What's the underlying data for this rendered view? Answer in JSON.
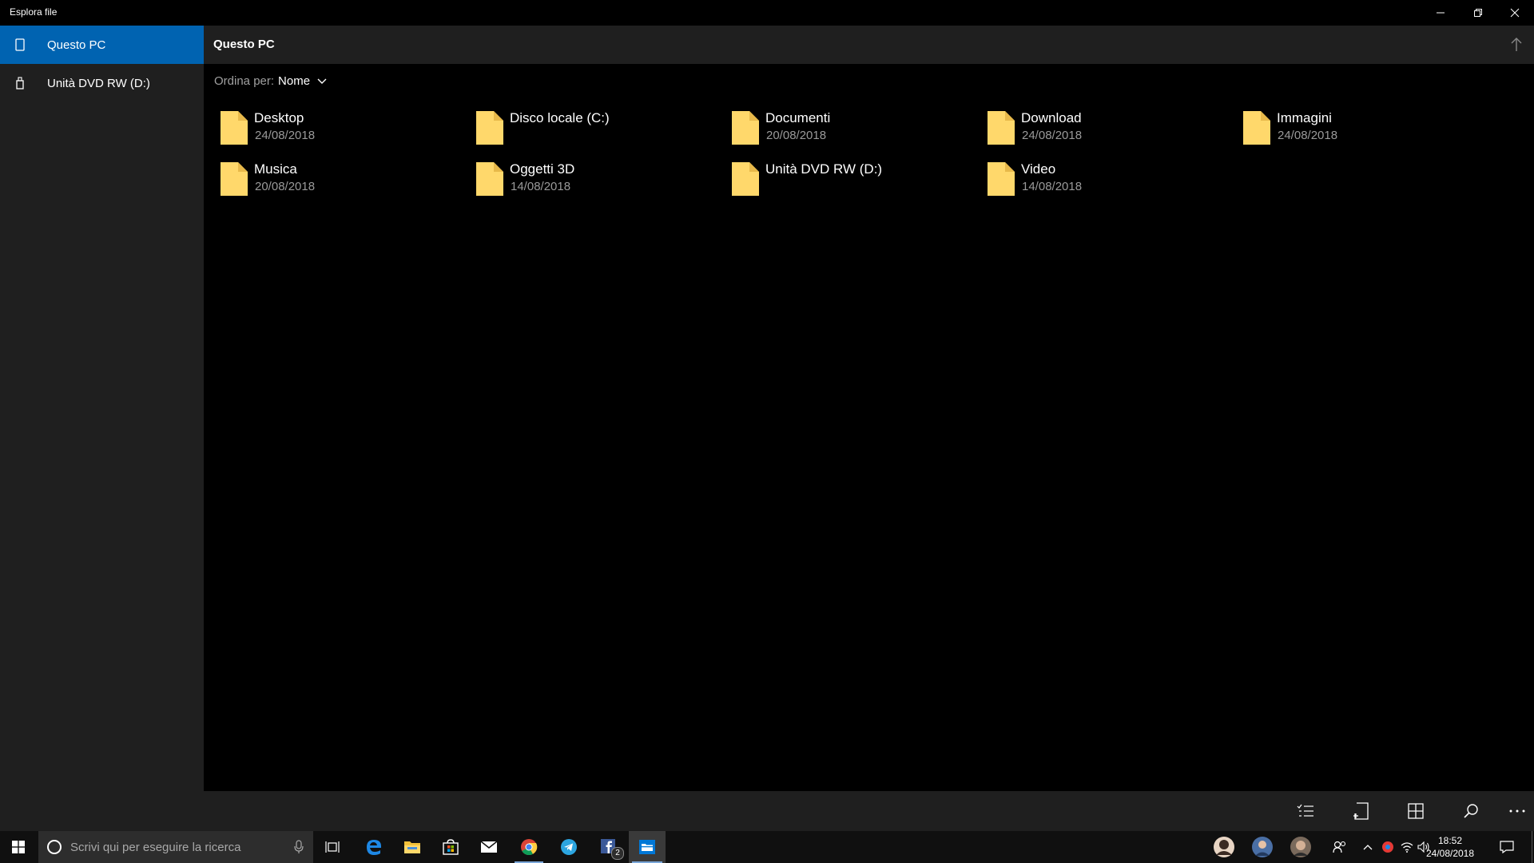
{
  "window": {
    "title": "Esplora file"
  },
  "sidebar": {
    "items": [
      {
        "label": "Questo PC",
        "icon": "phone-device-icon",
        "selected": true
      },
      {
        "label": "Unità DVD RW (D:)",
        "icon": "usb-drive-icon",
        "selected": false
      }
    ]
  },
  "header": {
    "title": "Questo PC"
  },
  "sort": {
    "label": "Ordina per:",
    "value": "Nome"
  },
  "items": [
    {
      "name": "Desktop",
      "date": "24/08/2018"
    },
    {
      "name": "Disco locale (C:)",
      "date": ""
    },
    {
      "name": "Documenti",
      "date": "20/08/2018"
    },
    {
      "name": "Download",
      "date": "24/08/2018"
    },
    {
      "name": "Immagini",
      "date": "24/08/2018"
    },
    {
      "name": "Musica",
      "date": "20/08/2018"
    },
    {
      "name": "Oggetti 3D",
      "date": "14/08/2018"
    },
    {
      "name": "Unità DVD RW (D:)",
      "date": ""
    },
    {
      "name": "Video",
      "date": "14/08/2018"
    }
  ],
  "taskbar": {
    "search_placeholder": "Scrivi qui per eseguire la ricerca",
    "time": "18:52",
    "date": "24/08/2018",
    "facebook_badge": "2"
  },
  "colors": {
    "accent": "#0063b1",
    "folder": "#ffd86b",
    "sidebar_bg": "#1f1f1f",
    "content_bg": "#000000"
  }
}
